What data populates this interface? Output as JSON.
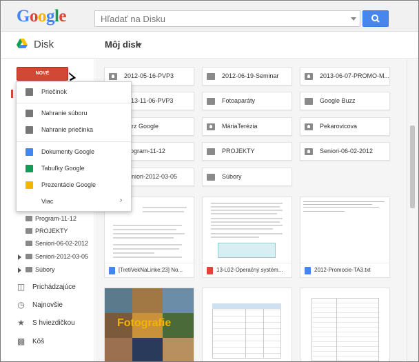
{
  "header": {
    "logo_text": "Google",
    "search_placeholder": "Hľadať na Disku"
  },
  "subheader": {
    "app_name": "Disk",
    "location": "Môj disk"
  },
  "sidebar": {
    "new_button": "NOVÉ",
    "tree_items": [
      {
        "label": "Program-11-12",
        "expandable": false
      },
      {
        "label": "PROJEKTY",
        "expandable": false
      },
      {
        "label": "Seniori-06-02-2012",
        "expandable": false
      },
      {
        "label": "Seniori-2012-03-05",
        "expandable": true
      },
      {
        "label": "Súbory",
        "expandable": true
      }
    ],
    "nav_items": [
      {
        "label": "Prichádzajúce",
        "icon": "incoming-icon"
      },
      {
        "label": "Najnovšie",
        "icon": "clock-icon"
      },
      {
        "label": "S hviezdičkou",
        "icon": "star-icon"
      },
      {
        "label": "Kôš",
        "icon": "trash-icon"
      }
    ]
  },
  "menu": {
    "items": [
      {
        "label": "Priečinok",
        "icon": "new-folder-icon",
        "color": "#777777"
      },
      {
        "label": "Nahranie súboru",
        "icon": "upload-file-icon",
        "color": "#777777"
      },
      {
        "label": "Nahranie priečinka",
        "icon": "upload-folder-icon",
        "color": "#777777"
      },
      {
        "label": "Dokumenty Google",
        "icon": "docs-icon",
        "color": "#4285f4"
      },
      {
        "label": "Tabuľky Google",
        "icon": "sheets-icon",
        "color": "#0f9d58"
      },
      {
        "label": "Prezentácie Google",
        "icon": "slides-icon",
        "color": "#f4b400"
      },
      {
        "label": "Viac",
        "icon": "more-icon",
        "color": "#ffffff"
      }
    ]
  },
  "folders": [
    {
      "label": "2012-05-16-PVP3",
      "shared": true
    },
    {
      "label": "2012-06-19-Seminar",
      "shared": false
    },
    {
      "label": "2013-06-07-PROMO-M...",
      "shared": true
    },
    {
      "label": "2013-11-06-PVP3",
      "shared": true
    },
    {
      "label": "Fotoaparáty",
      "shared": false
    },
    {
      "label": "Google Buzz",
      "shared": false
    },
    {
      "label": "Kurz Google",
      "shared": true
    },
    {
      "label": "MáriaTerézia",
      "shared": true
    },
    {
      "label": "Pekarovicova",
      "shared": true
    },
    {
      "label": "Program-11-12",
      "shared": false
    },
    {
      "label": "PROJEKTY",
      "shared": false
    },
    {
      "label": "Seniori-06-02-2012",
      "shared": true
    },
    {
      "label": "Seniori-2012-03-05",
      "shared": true
    },
    {
      "label": "Súbory",
      "shared": false
    }
  ],
  "files": [
    {
      "name": "[TretiVekNaLinke:23] No...",
      "icon": "docs-file-icon",
      "color": "#4285f4"
    },
    {
      "name": "13-L02-Operačný systém...",
      "icon": "pdf-file-icon",
      "color": "#db4437"
    },
    {
      "name": "2012-Promocie-TA3.txt",
      "icon": "txt-file-icon",
      "color": "#4285f4"
    }
  ],
  "thumbnail_text": {
    "photo_caption": "Fotografie"
  },
  "colors": {
    "new_button": "#d14836",
    "search_button": "#4787ed"
  }
}
